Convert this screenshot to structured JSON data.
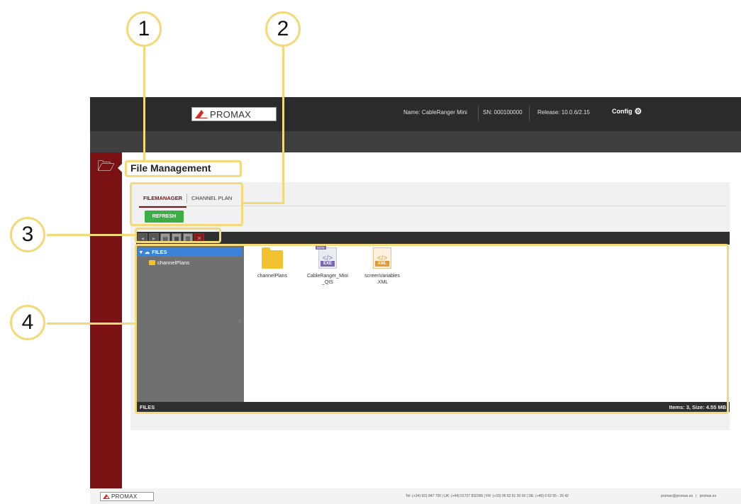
{
  "header": {
    "logo_text": "PROMAX",
    "device_name": "Name: CableRanger Mini",
    "serial": "SN: 000100000",
    "release": "Release: 10.0.6/2.15",
    "config_label": "Config",
    "config_icon": "gear-icon"
  },
  "sidebar": {
    "icon": "folder-open-icon"
  },
  "main": {
    "title": "File Management",
    "tabs": [
      {
        "label": "FILEMANAGER",
        "active": true
      },
      {
        "label": "CHANNEL PLAN",
        "active": false
      }
    ],
    "refresh_label": "REFRESH"
  },
  "file_manager": {
    "tree_root": "FILES",
    "tree_children": [
      "channelPlans"
    ],
    "files": [
      {
        "name": "channelPlans",
        "type": "folder"
      },
      {
        "name_line1": "CableRanger_Mini",
        "name_line2": "_QtS",
        "type": "exe",
        "tag": "EXE",
        "badge": "NEW"
      },
      {
        "name_line1": "screenVariables",
        "name_line2": ".XML",
        "type": "xml",
        "tag": "XML"
      }
    ],
    "status_left": "FILES",
    "status_right": "Items: 3, Size: 4.55 MB"
  },
  "footer": {
    "logo_text": "PROMAX",
    "contacts": "Tel: (+34) 931 847 700   |   UK: (+44) 01727 832266   |   FR: (+33) 06 62 61 20 00   |   DE: (+49) 0 62 55 - 20 42",
    "email": "promax@promax.es",
    "site": "promax.es"
  },
  "annotations": {
    "c1": "1",
    "c2": "2",
    "c3": "3",
    "c4": "4"
  },
  "colors": {
    "accent": "#7a1214",
    "highlight": "#f3d97a",
    "refresh": "#3cae45",
    "selected": "#3b82d8"
  }
}
